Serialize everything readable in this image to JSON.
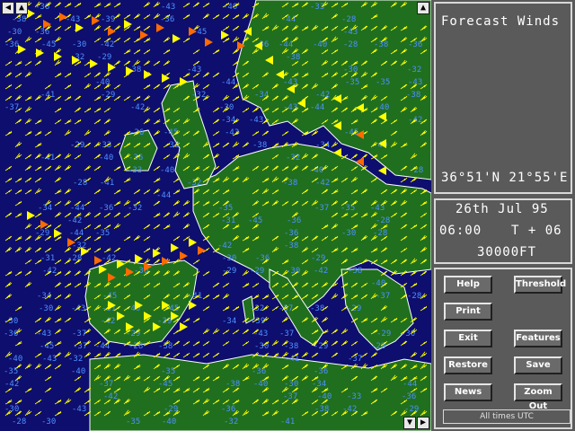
{
  "panel": {
    "title": "Forecast Winds",
    "coordinates": "36°51'N 21°55'E",
    "date": "26th Jul 95",
    "time": "06:00",
    "forecast_offset": "T + 06",
    "altitude": "30000FT",
    "status": "All times UTC"
  },
  "buttons": {
    "help": "Help",
    "threshold": "Threshold",
    "print": "Print",
    "exit": "Exit",
    "features": "Features",
    "restore": "Restore",
    "save": "Save",
    "news": "News",
    "zoom_out": "Zoom Out"
  },
  "scroll": {
    "left": "◀",
    "up": "▲",
    "down": "▼",
    "right": "▶"
  },
  "map": {
    "sea_color": "#0e0e6e",
    "land_color": "#1f6f1f",
    "label_color": "#4f8fff",
    "barb_color": "#ffff00",
    "jet_color": "#ff6a00",
    "labels": [
      {
        "text": "-42"
      },
      {
        "text": "-40"
      },
      {
        "text": "-38"
      },
      {
        "text": "-37"
      },
      {
        "text": "-36"
      },
      {
        "text": "-39"
      },
      {
        "text": "-44"
      },
      {
        "text": "-43"
      },
      {
        "text": "-35"
      },
      {
        "text": "-34"
      },
      {
        "text": "-33"
      },
      {
        "text": "-32"
      },
      {
        "text": "-31"
      },
      {
        "text": "-30"
      },
      {
        "text": "-29"
      },
      {
        "text": "-28"
      },
      {
        "text": "-41"
      },
      {
        "text": "-45"
      }
    ]
  }
}
